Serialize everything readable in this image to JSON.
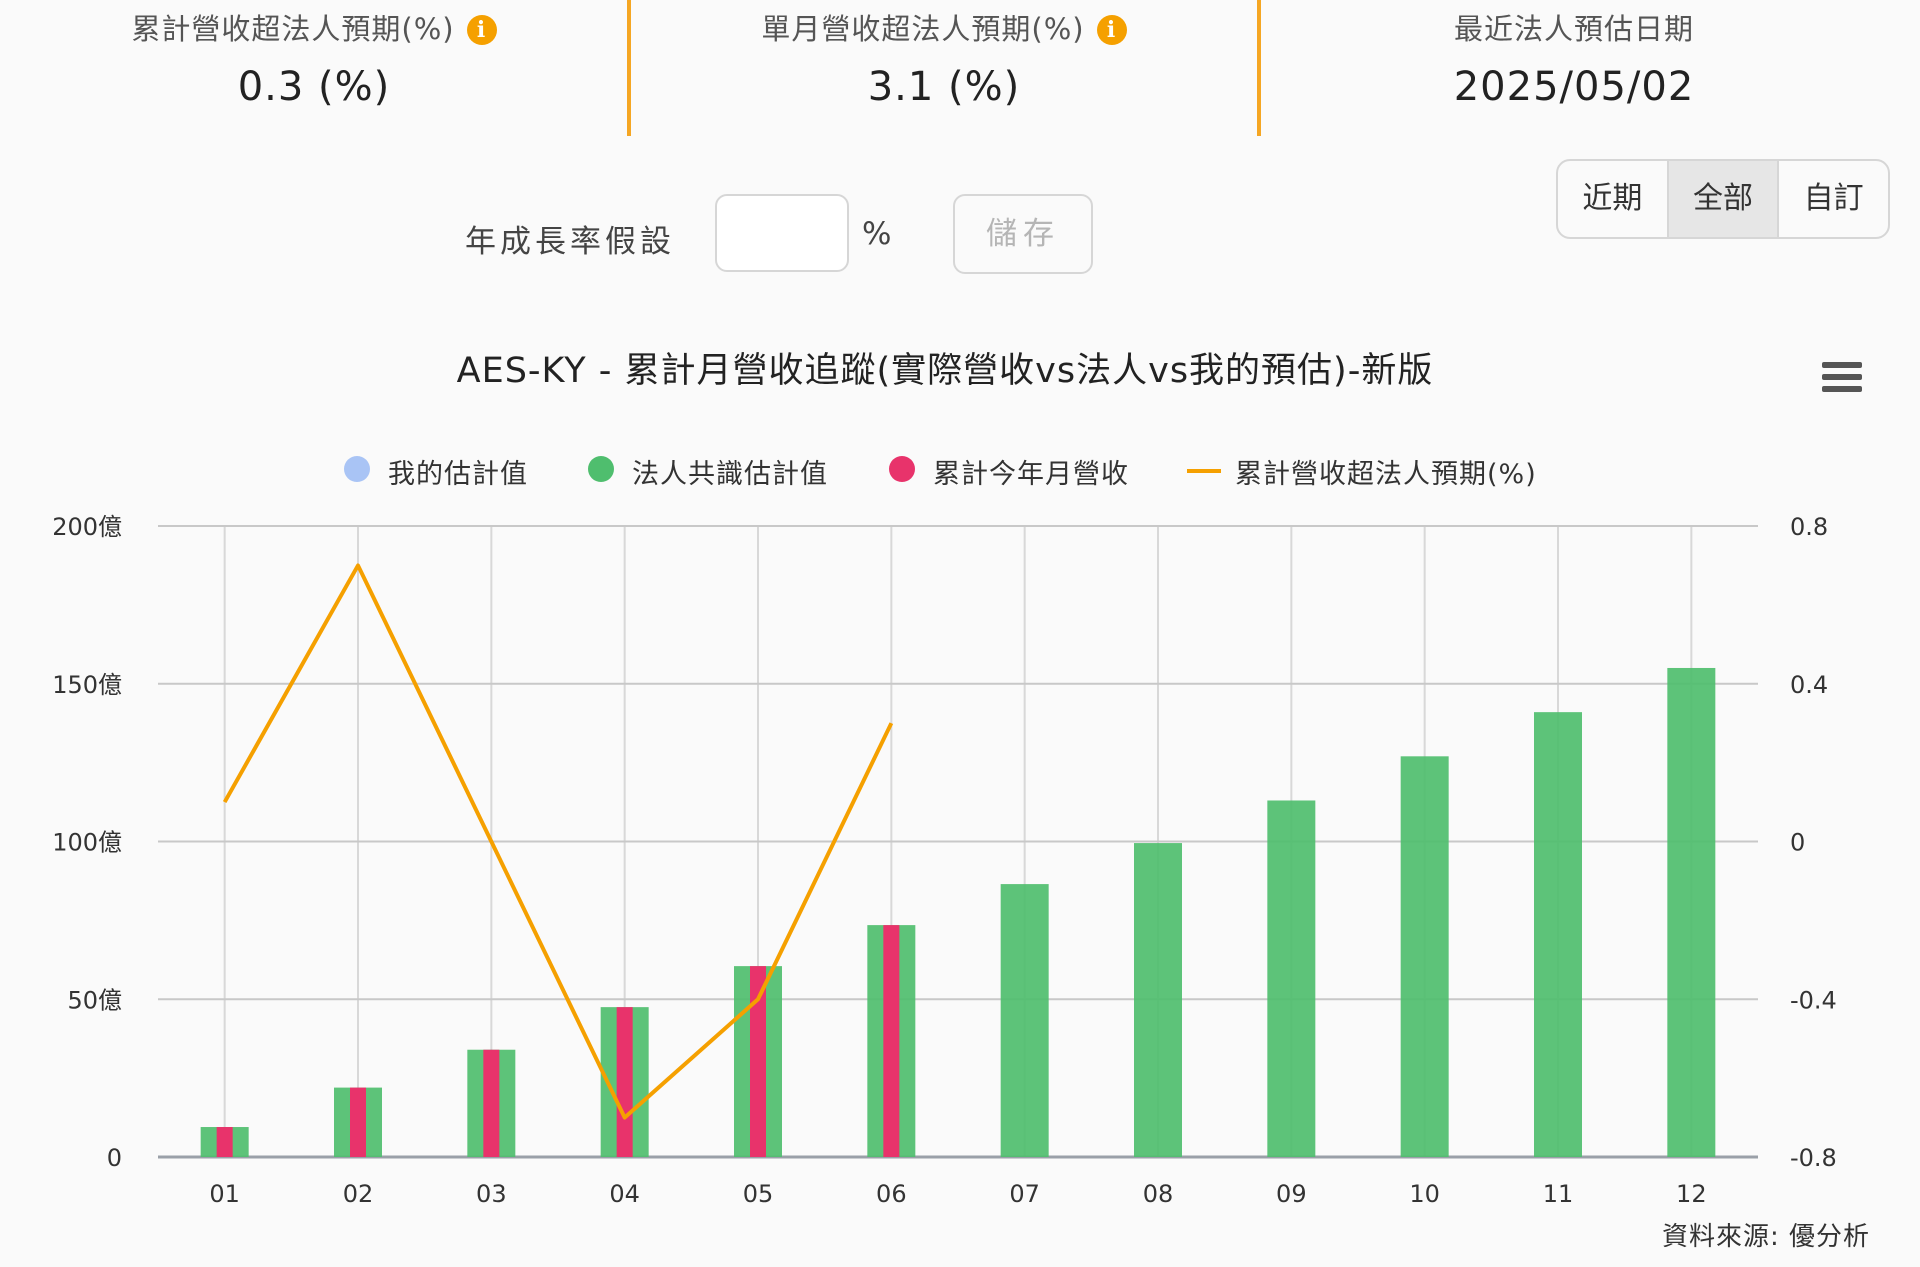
{
  "stats": [
    {
      "label": "累計營收超法人預期(%)",
      "value": "0.3 (%)",
      "info": true
    },
    {
      "label": "單月營收超法人預期(%)",
      "value": "3.1 (%)",
      "info": true
    },
    {
      "label": "最近法人預估日期",
      "value": "2025/05/02",
      "info": false
    }
  ],
  "info_icon": "i",
  "growth": {
    "label": "年成長率假設",
    "input_value": "",
    "unit": "%",
    "save_label": "儲存"
  },
  "range_buttons": [
    {
      "label": "近期",
      "active": false
    },
    {
      "label": "全部",
      "active": true
    },
    {
      "label": "自訂",
      "active": false
    }
  ],
  "source": "資料來源: 優分析",
  "colors": {
    "accent": "#f5a623",
    "my_estimate": "#a9c4f5",
    "consensus": "#4fbe6e",
    "actual": "#e8336b",
    "line": "#f5a000"
  },
  "chart_data": {
    "type": "bar",
    "title": "AES-KY - 累計月營收追蹤(實際營收vs法人vs我的預估)-新版",
    "categories": [
      "01",
      "02",
      "03",
      "04",
      "05",
      "06",
      "07",
      "08",
      "09",
      "10",
      "11",
      "12"
    ],
    "series": [
      {
        "name": "我的估計值",
        "type": "bar",
        "axis": "left",
        "values": [
          null,
          null,
          null,
          null,
          null,
          null,
          null,
          null,
          null,
          null,
          null,
          null
        ]
      },
      {
        "name": "法人共識估計值",
        "type": "bar",
        "axis": "left",
        "values": [
          9.5,
          22,
          34,
          47.5,
          60.5,
          73.5,
          86.5,
          99.5,
          113,
          127,
          141,
          155
        ]
      },
      {
        "name": "累計今年月營收",
        "type": "bar",
        "axis": "left",
        "values": [
          9.5,
          22,
          34,
          47.5,
          60.5,
          73.5,
          null,
          null,
          null,
          null,
          null,
          null
        ]
      },
      {
        "name": "累計營收超法人預期(%)",
        "type": "line",
        "axis": "right",
        "values": [
          0.1,
          0.7,
          0.0,
          -0.7,
          -0.4,
          0.3,
          null,
          null,
          null,
          null,
          null,
          null
        ]
      }
    ],
    "ylim_left": [
      0,
      200
    ],
    "ylim_right": [
      -0.8,
      0.8
    ],
    "y_ticks_left": [
      "0",
      "50億",
      "100億",
      "150億",
      "200億"
    ],
    "y_ticks_right": [
      "-0.8",
      "-0.4",
      "0",
      "0.4",
      "0.8"
    ],
    "legend_position": "top-center",
    "grid": true
  }
}
